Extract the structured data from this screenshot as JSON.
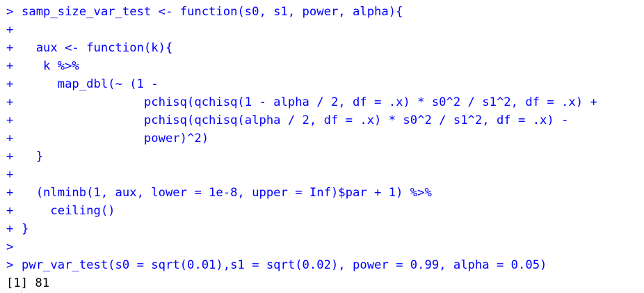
{
  "console": {
    "lines": [
      {
        "type": "input",
        "prompt": ">",
        "text": "samp_size_var_test <- function(s0, s1, power, alpha){"
      },
      {
        "type": "input",
        "prompt": "+",
        "text": ""
      },
      {
        "type": "input",
        "prompt": "+",
        "text": "  aux <- function(k){"
      },
      {
        "type": "input",
        "prompt": "+",
        "text": "   k %>%"
      },
      {
        "type": "input",
        "prompt": "+",
        "text": "     map_dbl(~ (1 -"
      },
      {
        "type": "input",
        "prompt": "+",
        "text": "                 pchisq(qchisq(1 - alpha / 2, df = .x) * s0^2 / s1^2, df = .x) +"
      },
      {
        "type": "input",
        "prompt": "+",
        "text": "                 pchisq(qchisq(alpha / 2, df = .x) * s0^2 / s1^2, df = .x) -"
      },
      {
        "type": "input",
        "prompt": "+",
        "text": "                 power)^2)"
      },
      {
        "type": "input",
        "prompt": "+",
        "text": "  }"
      },
      {
        "type": "input",
        "prompt": "+",
        "text": ""
      },
      {
        "type": "input",
        "prompt": "+",
        "text": "  (nlminb(1, aux, lower = 1e-8, upper = Inf)$par + 1) %>%"
      },
      {
        "type": "input",
        "prompt": "+",
        "text": "    ceiling()"
      },
      {
        "type": "input",
        "prompt": "+",
        "text": "}"
      },
      {
        "type": "input",
        "prompt": ">",
        "text": ""
      },
      {
        "type": "input",
        "prompt": ">",
        "text": "pwr_var_test(s0 = sqrt(0.01),s1 = sqrt(0.02), power = 0.99, alpha = 0.05)"
      },
      {
        "type": "output",
        "prompt": "",
        "text": "[1] 81"
      }
    ]
  }
}
